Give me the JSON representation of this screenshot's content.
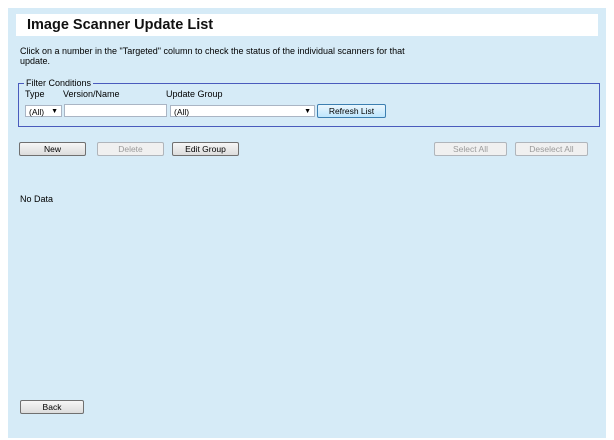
{
  "page": {
    "title": "Image Scanner Update List",
    "instruction": "Click on a number in the \"Targeted\" column to check the status of the individual scanners for that update."
  },
  "filter": {
    "legend": "Filter Conditions",
    "type_label": "Type",
    "version_label": "Version/Name",
    "group_label": "Update Group",
    "type_value": "(All)",
    "version_value": "",
    "group_value": "(All)",
    "refresh_label": "Refresh List"
  },
  "toolbar": {
    "new_label": "New",
    "delete_label": "Delete",
    "edit_group_label": "Edit Group",
    "select_all_label": "Select All",
    "deselect_all_label": "Deselect All"
  },
  "list": {
    "empty_text": "No Data"
  },
  "footer": {
    "back_label": "Back"
  }
}
